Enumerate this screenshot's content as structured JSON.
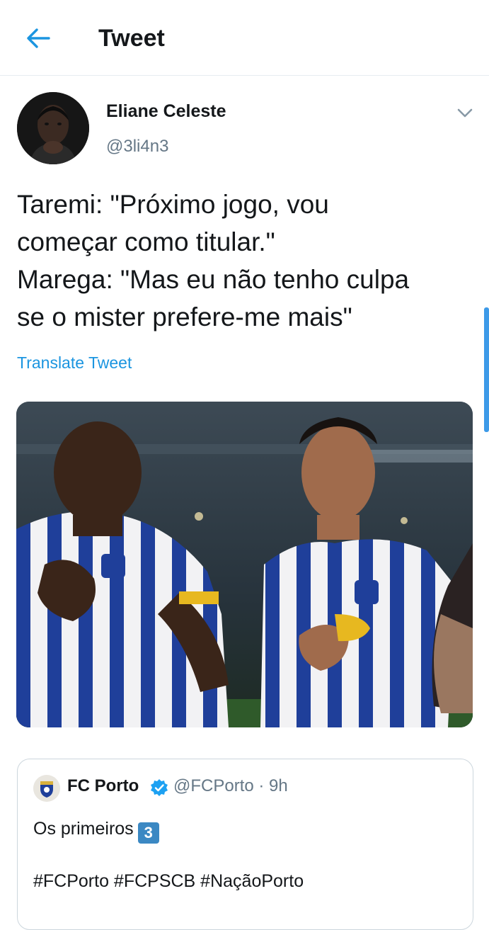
{
  "header": {
    "title": "Tweet"
  },
  "tweet": {
    "author_name": "Eliane Celeste",
    "author_handle": "@3li4n3",
    "text_lines": [
      "Taremi: \"Próximo jogo, vou",
      "começar como titular.\"",
      "Marega: \"Mas eu não tenho culpa",
      "se o mister prefere-me mais\""
    ],
    "translate_label": "Translate Tweet"
  },
  "quoted": {
    "name": "FC Porto",
    "handle_time": "@FCPorto · 9h",
    "text_prefix": "Os primeiros",
    "keycap": "3",
    "hashtags": "#FCPorto #FCPSCB #NaçãoPorto"
  },
  "colors": {
    "accent": "#1b95e0",
    "text": "#14171a",
    "secondary": "#657786",
    "border": "#e6ecf0"
  },
  "icons": {
    "back": "arrow-left-icon",
    "more": "chevron-down-icon",
    "verified": "verified-badge-icon"
  }
}
